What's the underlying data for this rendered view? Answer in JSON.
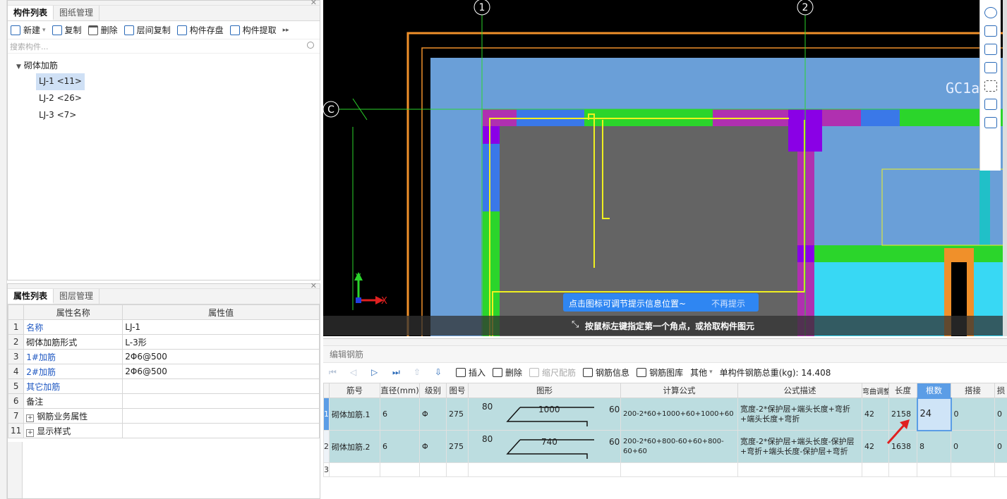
{
  "components_panel": {
    "tabs": [
      "构件列表",
      "图纸管理"
    ],
    "toolbar": [
      "新建",
      "复制",
      "删除",
      "层间复制",
      "构件存盘",
      "构件提取"
    ],
    "search_placeholder": "搜索构件...",
    "tree_root": "砌体加筋",
    "items": [
      "LJ-1 <11>",
      "LJ-2 <26>",
      "LJ-3 <7>"
    ]
  },
  "properties_panel": {
    "tabs": [
      "属性列表",
      "图层管理"
    ],
    "headers": [
      "属性名称",
      "属性值"
    ],
    "rows": [
      {
        "num": "1",
        "name": "名称",
        "value": "LJ-1"
      },
      {
        "num": "2",
        "name": "砌体加筋形式",
        "value": "L-3形"
      },
      {
        "num": "3",
        "name": "1#加筋",
        "value": "2Φ6@500"
      },
      {
        "num": "4",
        "name": "2#加筋",
        "value": "2Φ6@500"
      },
      {
        "num": "5",
        "name": "其它加筋",
        "value": ""
      },
      {
        "num": "6",
        "name": "备注",
        "value": ""
      },
      {
        "num": "7",
        "name": "钢筋业务属性",
        "value": ""
      },
      {
        "num": "11",
        "name": "显示样式",
        "value": ""
      }
    ]
  },
  "canvas": {
    "axis_labels": [
      "1",
      "2",
      "C"
    ],
    "axis_y": "Y",
    "axis_x": "X",
    "element_label": "GC1a",
    "tip_text": "点击图标可调节提示信息位置~",
    "tip_dismiss": "不再提示",
    "hint_text": "按鼠标左键指定第一个角点，或拾取构件图元",
    "colors": {
      "wall": "#6a9fd8",
      "room": "#646464",
      "green": "#2bd52b",
      "magenta": "#b030b0",
      "purple": "#8a00e6",
      "cyan": "#38d8f4",
      "orange": "#f0902a",
      "yellow": "#f0f020"
    }
  },
  "editor": {
    "title": "编辑钢筋",
    "toolbar": [
      "插入",
      "删除",
      "缩尺配筋",
      "钢筋信息",
      "钢筋图库",
      "其他"
    ],
    "total_weight": "单构件钢筋总重(kg): 14.408",
    "headers": [
      "筋号",
      "直径(mm)",
      "级别",
      "图号",
      "图形",
      "计算公式",
      "公式描述",
      "弯曲调整",
      "长度",
      "根数",
      "搭接",
      "损"
    ],
    "rows": [
      {
        "num": "1",
        "name": "砌体加筋.1",
        "diameter": "6",
        "grade": "Φ",
        "fig": "275",
        "shape_left": "80",
        "shape_mid": "1000",
        "shape_right": "60",
        "formula": "200-2*60+1000+60+1000+60",
        "desc": "宽度-2*保护层+端头长度+弯折+端头长度+弯折",
        "bend": "42",
        "length": "2158",
        "count": "24",
        "lap": "0",
        "loss": "0"
      },
      {
        "num": "2",
        "name": "砌体加筋.2",
        "diameter": "6",
        "grade": "Φ",
        "fig": "275",
        "shape_left": "80",
        "shape_mid": "740",
        "shape_right": "60",
        "formula": "200-2*60+800-60+60+800-60+60",
        "desc": "宽度-2*保护层+端头长度-保护层+弯折+端头长度-保护层+弯折",
        "bend": "42",
        "length": "1638",
        "count": "8",
        "lap": "0",
        "loss": "0"
      },
      {
        "num": "3"
      }
    ]
  }
}
